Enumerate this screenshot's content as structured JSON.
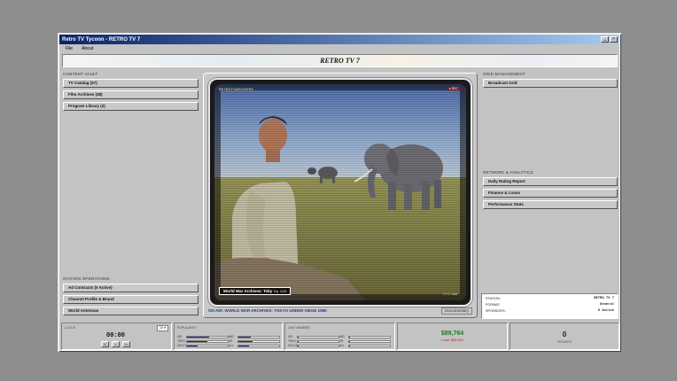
{
  "window": {
    "title": "Retro TV Tycoon - RETRO TV 7"
  },
  "menu": {
    "items": [
      "File",
      "About"
    ]
  },
  "banner": {
    "title": "RETRO TV 7"
  },
  "content_vault": {
    "label": "CONTENT VAULT",
    "buttons": [
      "TV Catalog (57)",
      "Film Archives (38)",
      "Program Library (2)"
    ]
  },
  "station_ops": {
    "label": "STATION OPERATIONS",
    "buttons": [
      "Ad Contracts (0 Active)",
      "Channel Profile & Brand",
      "World Antennas"
    ]
  },
  "grid_management": {
    "label": "GRID MANAGEMENT",
    "buttons": [
      "Broadcast Grid"
    ]
  },
  "network_analytics": {
    "label": "NETWORK & ANALYTICS",
    "buttons": [
      "Daily Rating Report",
      "Finance & Loans",
      "Performance Stats"
    ]
  },
  "tv": {
    "logo": "RETROTVARCHIVES",
    "rec": "● REC",
    "caption_title": "World War Archives: Toky",
    "caption_ep": "Ep. 1/10",
    "timecode": "00:01  ■■■",
    "on_air": "ON AIR: WORLD WAR ARCHIVES: TOKYO UNDER SIEGE 1985",
    "genre": "Documentary"
  },
  "station_info": {
    "rows": [
      {
        "k": "STATION:",
        "v": "RETRO TV 7"
      },
      {
        "k": "FORMAT:",
        "v": "General"
      },
      {
        "k": "SPONSORS:",
        "v": "0 Active"
      }
    ]
  },
  "bottom": {
    "clock_label": "CLOCK",
    "time": "00:00",
    "speed": "1X ▾",
    "controls": [
      "II",
      ">",
      ">>"
    ],
    "popularity_label": "POPULARITY",
    "popularity": [
      {
        "l": "KID",
        "v": 0.55
      },
      {
        "l": "TEEN",
        "v": 0.5
      },
      {
        "l": "ADULT",
        "v": 0.25
      },
      {
        "l": "MID",
        "v": 0.3
      },
      {
        "l": "SR",
        "v": 0.35
      },
      {
        "l": "ALL",
        "v": 0.25
      }
    ],
    "live_viewers_label": "LIVE VIEWERS",
    "live": [
      {
        "l": "KID",
        "v": 0.02
      },
      {
        "l": "TEEN",
        "v": 0.02
      },
      {
        "l": "ADULT",
        "v": 0.02
      },
      {
        "l": "MID",
        "v": 0.02
      },
      {
        "l": "SR",
        "v": 0.02
      },
      {
        "l": "ALL",
        "v": 0.02
      }
    ],
    "money": "$89,764",
    "money_sub": "Loan: $50,000",
    "count": "0",
    "count_sub": "VIEWERS"
  },
  "colors": {
    "accent": "#0a246a",
    "money": "#1e7a2c",
    "bar": "#1e2f8f"
  }
}
